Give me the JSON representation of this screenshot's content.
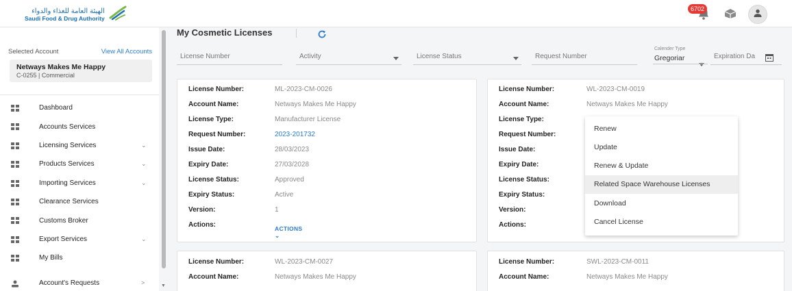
{
  "header": {
    "logo_ar": "الهيئة العامة للغذاء والدواء",
    "logo_en": "Saudi Food & Drug Authority",
    "notification_count": "6702"
  },
  "sidebar": {
    "selected_account_label": "Selected Account",
    "view_all_label": "View All Accounts",
    "account_name": "Netways Makes Me Happy",
    "account_code": "C-0255 | Commercial",
    "items": [
      {
        "label": "Dashboard",
        "chevron": ""
      },
      {
        "label": "Accounts Services",
        "chevron": ""
      },
      {
        "label": "Licensing Services",
        "chevron": "⌄"
      },
      {
        "label": "Products Services",
        "chevron": "⌄"
      },
      {
        "label": "Importing Services",
        "chevron": "⌄"
      },
      {
        "label": "Clearance Services",
        "chevron": ""
      },
      {
        "label": "Customs Broker",
        "chevron": ""
      },
      {
        "label": "Export Services",
        "chevron": "⌄"
      },
      {
        "label": "My Bills",
        "chevron": ""
      },
      {
        "label": "Account's Requests",
        "chevron": ">"
      }
    ]
  },
  "main": {
    "title": "My Cosmetic Licenses",
    "filters": {
      "license_number": "License Number",
      "activity": "Activity",
      "license_status": "License Status",
      "request_number": "Request Number",
      "calendar_type_label": "Calender Type",
      "calendar_type_value": "Gregoriar",
      "expiration_date": "Expiration Da"
    },
    "field_labels": {
      "license_number": "License Number:",
      "account_name": "Account Name:",
      "license_type": "License Type:",
      "request_number": "Request Number:",
      "issue_date": "Issue Date:",
      "expiry_date": "Expiry Date:",
      "license_status": "License Status:",
      "expiry_status": "Expiry Status:",
      "version": "Version:",
      "actions": "Actions:"
    },
    "cards": [
      {
        "license_number": "ML-2023-CM-0026",
        "account_name": "Netways Makes Me Happy",
        "license_type": "Manufacturer License",
        "request_number": "2023-201732",
        "issue_date": "28/03/2023",
        "expiry_date": "27/03/2028",
        "license_status": "Approved",
        "expiry_status": "Active",
        "version": "1",
        "actions_label": "ACTIONS ⌄"
      },
      {
        "license_number": "WL-2023-CM-0019",
        "account_name": "Netways Makes Me Happy"
      },
      {
        "license_number": "WL-2023-CM-0027",
        "account_name": "Netways Makes Me Happy"
      },
      {
        "license_number": "SWL-2023-CM-0011",
        "account_name": "Netways Makes Me Happy"
      }
    ],
    "actions_menu": [
      "Renew",
      "Update",
      "Renew & Update",
      "Related Space Warehouse Licenses",
      "Download",
      "Cancel License"
    ]
  },
  "colors": {
    "accent": "#2b7bd1",
    "badge": "#e53935",
    "logo": "#1b6fb3"
  }
}
